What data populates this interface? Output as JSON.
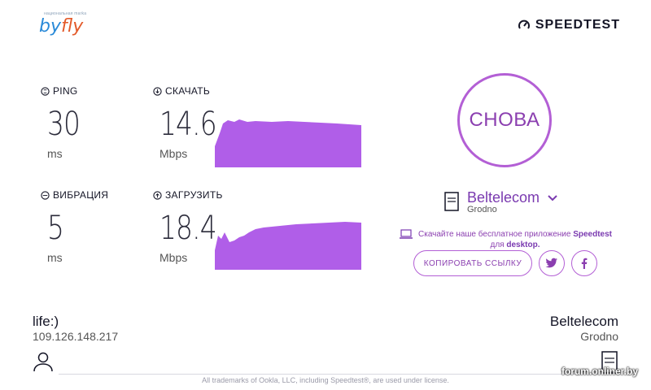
{
  "header": {
    "logo_tagline": "национальная marka",
    "logo_by": "by",
    "logo_fly": "fly",
    "brand": "SPEEDTEST",
    "brand_icon": "gauge-icon"
  },
  "metrics": {
    "ping": {
      "label": "PING",
      "value": "30",
      "unit": "ms",
      "icon": "ping-icon"
    },
    "download": {
      "label": "СКАЧАТЬ",
      "value": "14.6",
      "unit": "Mbps",
      "icon": "download-icon"
    },
    "jitter": {
      "label": "ВИБРАЦИЯ",
      "value": "5",
      "unit": "ms",
      "icon": "jitter-icon"
    },
    "upload": {
      "label": "ЗАГРУЗИТЬ",
      "value": "18.4",
      "unit": "Mbps",
      "icon": "upload-icon"
    }
  },
  "actions": {
    "again": "СНОВА",
    "copy_link": "КОПИРОВАТЬ ССЫЛКУ"
  },
  "server": {
    "name": "Beltelecom",
    "location": "Grodno"
  },
  "promo": {
    "text_before": "Скачайте наше бесплатное приложение ",
    "app": "Speedtest",
    "text_mid": " для ",
    "platform": "desktop."
  },
  "isp": {
    "name": "life:)",
    "ip": "109.126.148.217"
  },
  "host": {
    "name": "Beltelecom",
    "location": "Grodno"
  },
  "footer": "All trademarks of Ookla, LLC, including Speedtest®, are used under license.",
  "watermark": "forum.onliner.by",
  "colors": {
    "accent": "#b35fd5",
    "graph": "#b05ee8",
    "text": "#141526"
  }
}
